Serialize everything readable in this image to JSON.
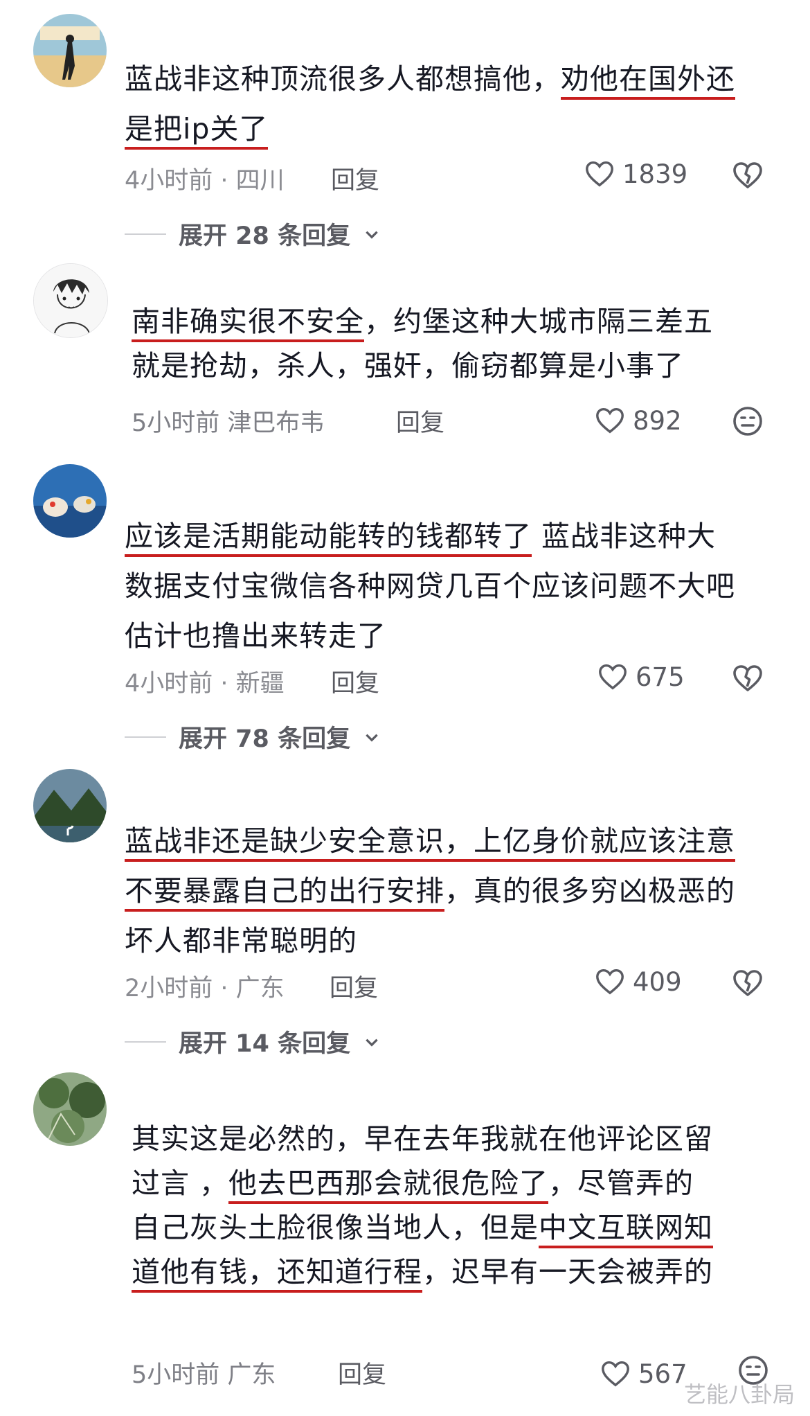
{
  "comments": [
    {
      "lines": [
        [
          {
            "t": "蓝战非这种顶流很多人都想搞他，",
            "u": false
          },
          {
            "t": "劝他在国外还",
            "u": true
          }
        ],
        [
          {
            "t": "是把ip关了",
            "u": true
          }
        ]
      ],
      "meta": "4小时前 · 四川",
      "reply": "回复",
      "likes": "1839",
      "expand": "展开 28 条回复",
      "reaction": "broken-heart-icon"
    },
    {
      "lines": [
        [
          {
            "t": "南非确实很不安全",
            "u": true
          },
          {
            "t": "，约堡这种大城市隔三差五",
            "u": false
          }
        ],
        [
          {
            "t": "就是抢劫，杀人，强奸，偷窃都算是小事了",
            "u": false
          }
        ]
      ],
      "meta": "5小时前 津巴布韦",
      "reply": "回复",
      "likes": "892",
      "expand": "",
      "reaction": "smile-face-icon"
    },
    {
      "lines": [
        [
          {
            "t": "应该是活期能动能转的钱都转了",
            "u": true
          },
          {
            "t": " 蓝战非这种大",
            "u": false
          }
        ],
        [
          {
            "t": "数据支付宝微信各种网贷几百个应该问题不大吧",
            "u": false
          }
        ],
        [
          {
            "t": "估计也撸出来转走了",
            "u": false
          }
        ]
      ],
      "meta": "4小时前 · 新疆",
      "reply": "回复",
      "likes": "675",
      "expand": "展开 78 条回复",
      "reaction": "broken-heart-icon"
    },
    {
      "lines": [
        [
          {
            "t": "蓝战非还是缺少安全意识，上亿身价就应该注意",
            "u": true
          }
        ],
        [
          {
            "t": "不要暴露自己的出行安排",
            "u": true
          },
          {
            "t": "，真的很多穷凶极恶的",
            "u": false
          }
        ],
        [
          {
            "t": "坏人都非常聪明的",
            "u": false
          }
        ]
      ],
      "meta": "2小时前 · 广东",
      "reply": "回复",
      "likes": "409",
      "expand": "展开 14 条回复",
      "reaction": "broken-heart-icon"
    },
    {
      "lines": [
        [
          {
            "t": "其实这是必然的，早在去年我就在他评论区留",
            "u": false
          }
        ],
        [
          {
            "t": "过言   ，",
            "u": false
          },
          {
            "t": "他去巴西那会就很危险了",
            "u": true
          },
          {
            "t": "，尽管弄的",
            "u": false
          }
        ],
        [
          {
            "t": "自己灰头土脸很像当地人，但是",
            "u": false
          },
          {
            "t": "中文互联网知",
            "u": true
          }
        ],
        [
          {
            "t": "道他有钱，还知道行程",
            "u": true
          },
          {
            "t": "，迟早有一天会被弄的",
            "u": false
          }
        ]
      ],
      "meta": "5小时前 广东",
      "reply": "回复",
      "likes": "567",
      "expand": "",
      "reaction": "smile-face-icon"
    }
  ],
  "watermark": "艺能八卦局"
}
